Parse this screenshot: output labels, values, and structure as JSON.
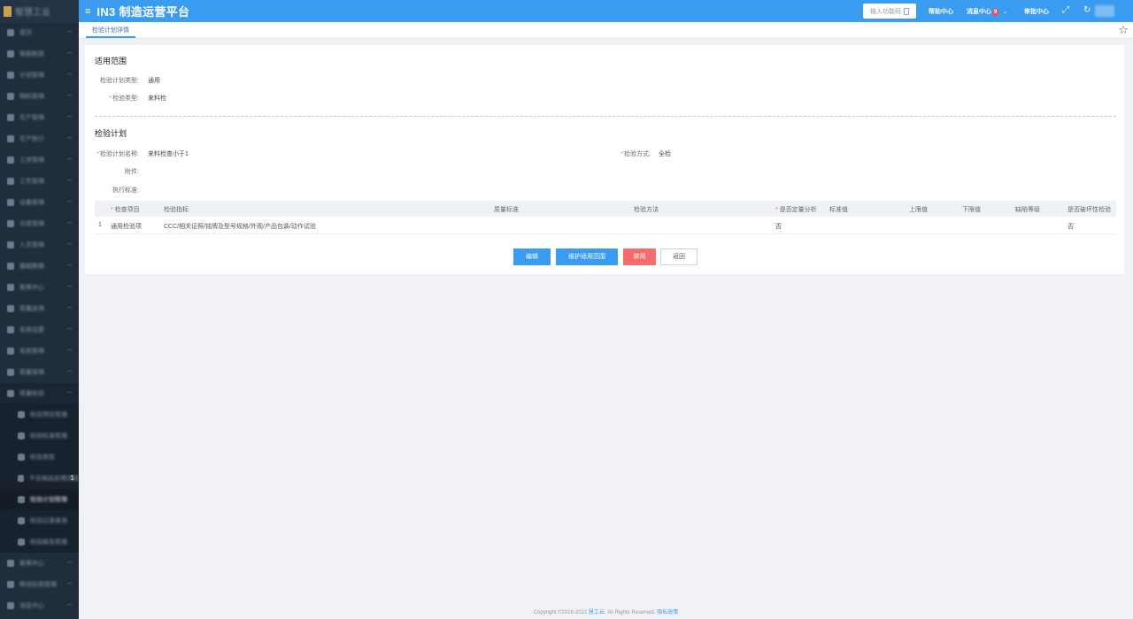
{
  "app": {
    "logo_text": "智慧工业",
    "title": "IN3 制造运营平台"
  },
  "header": {
    "search_placeholder": "输入功能码",
    "help": "帮助中心",
    "messages": "消息中心",
    "message_count": "9",
    "approval": "审批中心"
  },
  "sidebar": {
    "items": [
      {
        "label": "首页",
        "icon": "home-icon"
      },
      {
        "label": "智能制造",
        "icon": "chart-icon"
      },
      {
        "label": "计划管理",
        "icon": "calendar-icon"
      },
      {
        "label": "物料管理",
        "icon": "box-icon"
      },
      {
        "label": "生产管理",
        "icon": "factory-icon"
      },
      {
        "label": "生产执行",
        "icon": "play-icon"
      },
      {
        "label": "工序管理",
        "icon": "list-icon"
      },
      {
        "label": "工艺管理",
        "icon": "gear-icon"
      },
      {
        "label": "设备管理",
        "icon": "device-icon"
      },
      {
        "label": "仓库管理",
        "icon": "warehouse-icon"
      },
      {
        "label": "人员管理",
        "icon": "user-icon"
      },
      {
        "label": "基础数据",
        "icon": "database-icon"
      },
      {
        "label": "报表中心",
        "icon": "report-icon"
      },
      {
        "label": "质量追溯",
        "icon": "trace-icon"
      },
      {
        "label": "系统设置",
        "icon": "settings-icon"
      },
      {
        "label": "系统管理",
        "icon": "admin-icon"
      },
      {
        "label": "质量管理",
        "icon": "quality-icon"
      },
      {
        "label": "质量检验",
        "icon": "inspect-icon"
      }
    ],
    "sub_items": [
      {
        "label": "检验项目管理",
        "num": ""
      },
      {
        "label": "检验标准管理",
        "num": ""
      },
      {
        "label": "检验类型",
        "num": ""
      },
      {
        "label": "不合格品处理流程",
        "num": "1"
      },
      {
        "label": "检验计划管理",
        "num": ""
      },
      {
        "label": "检验记录查询",
        "num": ""
      },
      {
        "label": "检验报告管理",
        "num": ""
      }
    ],
    "bottom_items": [
      {
        "label": "报表中心",
        "icon": "report-icon"
      },
      {
        "label": "移动应用管理",
        "icon": "mobile-icon"
      },
      {
        "label": "消息中心",
        "icon": "bell-icon"
      }
    ]
  },
  "tabs": [
    {
      "label": "检验计划详情"
    }
  ],
  "scope": {
    "title": "适用范围",
    "plan_type_label": "检验计划类型:",
    "plan_type_value": "通用",
    "inspect_type_label": "检验类型:",
    "inspect_type_value": "来料检"
  },
  "plan": {
    "title": "检验计划",
    "name_label": "检验计划名称:",
    "name_value": "来料检查小于1",
    "method_label": "检验方式:",
    "method_value": "全检",
    "attachment_label": "附件:",
    "standard_label": "执行标准:"
  },
  "table": {
    "headers": [
      "检查项目",
      "检验指标",
      "质量标准",
      "检验方法",
      "是否定量分析",
      "标准值",
      "上限值",
      "下限值",
      "缺陷等级",
      "是否破坏性检验"
    ],
    "rows": [
      {
        "index": "1",
        "item": "通用检验项",
        "indicator": "CCC/相关证照/铭牌及型号规格/外观/产品包装/动作试验",
        "quality_standard": "",
        "method": "",
        "quantitative": "否",
        "standard_value": "",
        "upper": "",
        "lower": "",
        "defect_level": "",
        "destructive": "否"
      }
    ]
  },
  "buttons": {
    "edit": "编辑",
    "maintain_scope": "维护适用范围",
    "disable": "禁用",
    "back": "返回"
  },
  "footer": {
    "copyright": "Copyright ©2016-2022",
    "brand": "慧工云",
    "rights": ". All Rights Reserved.",
    "privacy": "隐私政策"
  },
  "colors": {
    "primary": "#3a9cf0",
    "danger": "#f56c6c",
    "sidebar": "#1f2d3d"
  }
}
